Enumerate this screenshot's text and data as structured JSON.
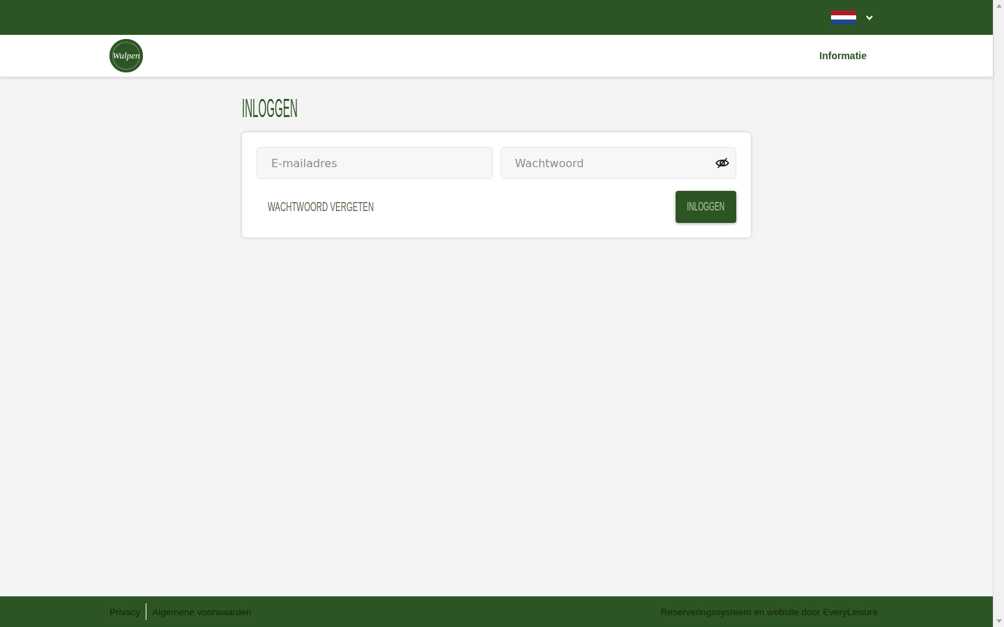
{
  "header": {
    "logo_text": "Wulpen",
    "nav_items": [
      {
        "label": "Informatie"
      }
    ]
  },
  "login": {
    "title": "INLOGGEN",
    "email_field": {
      "placeholder": "E-mailadres"
    },
    "password_field": {
      "placeholder": "Wachtwoord"
    },
    "forgot_link": "WACHTWOORD VERGETEN",
    "submit_button": "INLOGGEN"
  },
  "footer": {
    "links": [
      "Privacy",
      "Algemene voorwaarden"
    ],
    "credit": "Reserveringssysteem en website door EveryLeisure"
  }
}
